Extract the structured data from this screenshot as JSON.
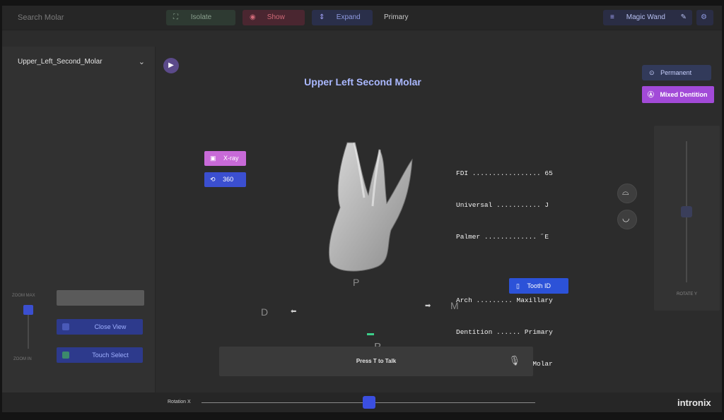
{
  "toolbar": {
    "search_placeholder": "Search Molar",
    "isolate_label": "Isolate",
    "show_label": "Show",
    "expand_label": "Expand",
    "primary_label": "Primary",
    "magic_wand_label": "Magic Wand"
  },
  "left_panel": {
    "selected_tooth": "Upper_Left_Second_Molar",
    "zoom_top_label": "ZOOM MAX",
    "zoom_bottom_label": "ZOOM IN",
    "close_view_label": "Close View",
    "touch_select_label": "Touch Select"
  },
  "viewer": {
    "title": "Upper Left Second Molar",
    "xray_label": "X-ray",
    "label_360": "360",
    "info_lines": [
      "FDI ................. 65",
      "Universal ........... J",
      "Palmer ............. ˝E",
      "",
      "Arch ......... Maxillary",
      "Dentition ...... Primary",
      "Type ...... Second Molar"
    ],
    "tooth_id_label": "Tooth ID",
    "dir_d": "D",
    "dir_m": "M",
    "dir_p": "P",
    "dir_b": "B",
    "voice_prompt": "Press T to Talk"
  },
  "right_panel": {
    "permanent_label": "Permanent",
    "mixed_dentition_label": "Mixed Dentition",
    "rotation_label": "ROTATE Y"
  },
  "bottom": {
    "rotation_label": "Rotation X",
    "rotation_value": 0.5,
    "brand": "intronix"
  },
  "colors": {
    "accent_blue": "#3b4fd0",
    "accent_purple": "#a24ad8",
    "xray_pink": "#c86ad8",
    "title_blue": "#aab8ff"
  }
}
